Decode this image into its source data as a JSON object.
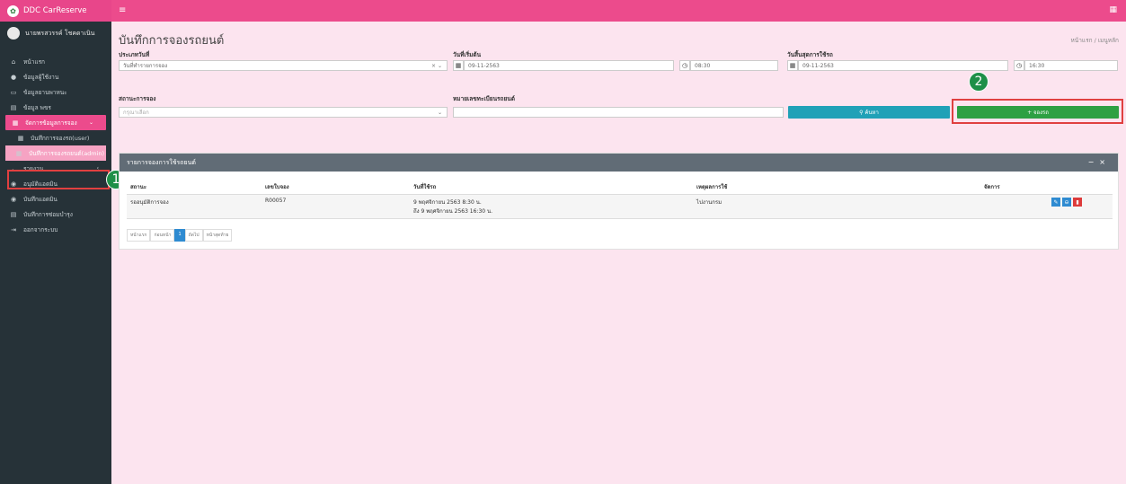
{
  "brand": {
    "title": "DDC CarReserve",
    "logo_icon": "leaf-logo-icon"
  },
  "topbar": {
    "menu_icon": "hamburger-icon",
    "apps_icon": "grid-icon"
  },
  "user": {
    "name": "นายพรสวรรค์ โชคดาเนิน"
  },
  "sidebar": {
    "items": [
      {
        "label": "หน้าแรก",
        "icon": "home-icon"
      },
      {
        "label": "ข้อมูลผู้ใช้งาน",
        "icon": "user-icon"
      },
      {
        "label": "ข้อมูลยานพาหนะ",
        "icon": "car-icon"
      },
      {
        "label": "ข้อมูล พขร",
        "icon": "id-card-icon"
      },
      {
        "label": "จัดการข้อมูลการจอง",
        "icon": "calendar-icon"
      },
      {
        "label": "บันทึกการจองรถ(user)",
        "icon": "calendar-icon"
      },
      {
        "label": "บันทึกการจองรถยนต์(admin)",
        "icon": "calendar-icon"
      },
      {
        "label": "รายงาน",
        "icon": "chart-icon"
      },
      {
        "label": "อนุมัติแอดมิน",
        "icon": "car-icon"
      },
      {
        "label": "บันทึกแอดมิน",
        "icon": "car-icon"
      },
      {
        "label": "บันทึกการซ่อมบำรุง",
        "icon": "wrench-icon"
      },
      {
        "label": "ออกจากระบบ",
        "icon": "logout-icon"
      }
    ]
  },
  "page": {
    "title": "บันทึกการจองรถยนต์",
    "breadcrumb": "หน้าแรก / เมนูหลัก"
  },
  "filters": {
    "type_label": "ประเภทวันที่",
    "type_value": "วันที่ทำรายการจอง",
    "start_label": "วันที่เริ่มต้น",
    "start_date": "09-11-2563",
    "start_time": "08:30",
    "end_label": "วันสิ้นสุดการใช้รถ",
    "end_date": "09-11-2563",
    "end_time": "16:30",
    "status_label": "สถานะการจอง",
    "status_placeholder": "กรุณาเลือก",
    "plate_label": "หมายเลขทะเบียนรถยนต์",
    "plate_value": "",
    "search_button": "ค้นหา",
    "book_button": "+ จองรถ"
  },
  "panel": {
    "title": "รายการจองการใช้รถยนต์",
    "columns": [
      "สถานะ",
      "เลขใบจอง",
      "วันที่ใช้รถ",
      "เหตุผลการใช้",
      "จัดการ"
    ],
    "rows": [
      {
        "status": "รออนุมัติการจอง",
        "booking_no": "R00057",
        "date_line1": "9 พฤศจิกายน 2563 8:30 น.",
        "date_line2": "ถึง 9 พฤศจิกายน 2563 16:30 น.",
        "reason": "ไปงานกรม"
      }
    ]
  },
  "pager": {
    "first": "หน้าแรก",
    "prev": "ก่อนหน้า",
    "current": "1",
    "next": "ถัดไป",
    "last": "หน้าสุดท้าย"
  },
  "callouts": {
    "one": "1",
    "two": "2"
  },
  "colors": {
    "accent": "#ec4b8c",
    "sidebar": "#263238",
    "search": "#20a1b7",
    "book": "#2ea043",
    "callout_green": "#1e8f48",
    "highlight_red": "#e04040"
  }
}
